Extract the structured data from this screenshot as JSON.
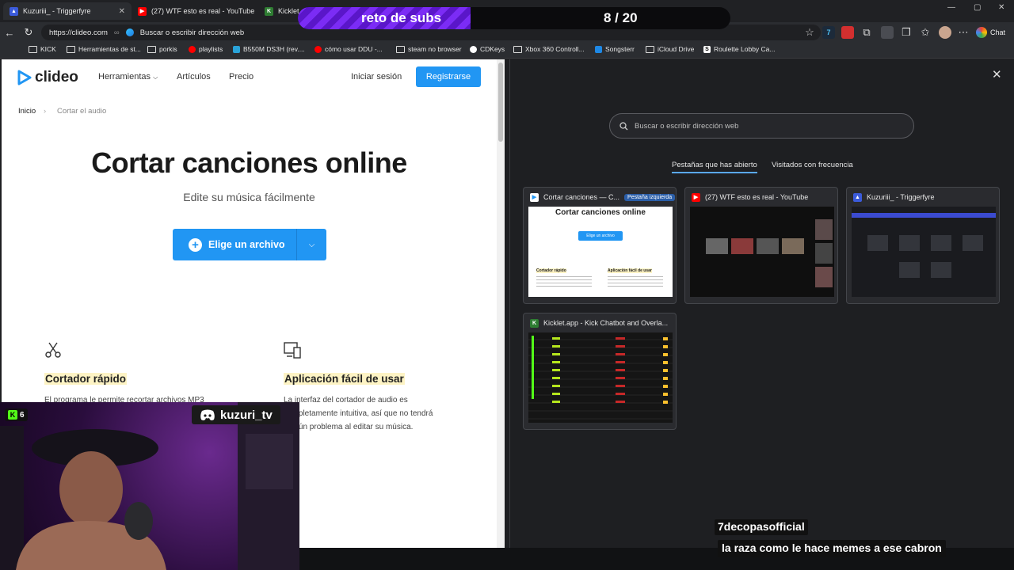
{
  "tabs": [
    {
      "title": "Kuzuriii_ - Triggerfyre",
      "favicon": "triggerfyre-icon",
      "color": "#3b5bdb"
    },
    {
      "title": "(27) WTF esto es real - YouTube",
      "favicon": "youtube-icon",
      "color": "#ff0000"
    },
    {
      "title": "Kicklet.ap",
      "favicon": "kicklet-icon",
      "color": "#2e7d32"
    }
  ],
  "address": {
    "url": "https://clideo.com",
    "placeholder": "Buscar o escribir dirección web"
  },
  "toolbar": {
    "chat_label": "Chat"
  },
  "bookmarks": [
    {
      "label": "KICK",
      "icon": "folder-icon"
    },
    {
      "label": "Herramientas de st...",
      "icon": "folder-icon"
    },
    {
      "label": "porkis",
      "icon": "folder-icon"
    },
    {
      "label": "playlists",
      "icon": "youtube-icon"
    },
    {
      "label": "B550M DS3H (rev....",
      "icon": "gigabyte-icon"
    },
    {
      "label": "cómo usar DDU -...",
      "icon": "youtube-icon"
    },
    {
      "label": "steam no browser",
      "icon": "folder-icon"
    },
    {
      "label": "CDKeys",
      "icon": "cdkeys-icon"
    },
    {
      "label": "Xbox 360 Controll...",
      "icon": "folder-icon"
    },
    {
      "label": "Songsterr",
      "icon": "songsterr-icon"
    },
    {
      "label": "iCloud Drive",
      "icon": "folder-icon"
    },
    {
      "label": "Roulette Lobby Ca...",
      "icon": "stake-icon"
    }
  ],
  "subs_goal": {
    "label": "reto de subs",
    "count": "8 / 20",
    "progress": 0.4
  },
  "clideo": {
    "logo": "clideo",
    "nav": {
      "tools": "Herramientas",
      "articles": "Artículos",
      "price": "Precio",
      "login": "Iniciar sesión",
      "register": "Registrarse"
    },
    "breadcrumb": {
      "home": "Inicio",
      "current": "Cortar el audio"
    },
    "title": "Cortar canciones online",
    "subtitle": "Edite su música fácilmente",
    "choose_button": "Elige un archivo",
    "features": [
      {
        "title": "Cortador rápido",
        "text": "El programa le permite recortar archivos MP3",
        "icon": "scissors-icon"
      },
      {
        "title": "Aplicación fácil de usar",
        "text": "La interfaz del cortador de audio es completamente intuitiva, así que no tendrá ningún problema al editar su música.",
        "icon": "devices-icon"
      }
    ]
  },
  "stream": {
    "kick_count": "6",
    "discord_name": "kuzuri_tv"
  },
  "newtab": {
    "search_placeholder": "Buscar o escribir dirección web",
    "tab_open": "Pestañas que has abierto",
    "tab_frequent": "Visitados con frecuencia",
    "cards": [
      {
        "title": "Cortar canciones — C...",
        "badge": "Pestaña izquierda",
        "preview_title": "Cortar canciones online",
        "preview_button": "Elige un archivo",
        "preview_f1": "Cortador rápido",
        "preview_f2": "Aplicación fácil de usar",
        "icon": "clideo-icon"
      },
      {
        "title": "(27) WTF esto es real - YouTube",
        "icon": "youtube-icon"
      },
      {
        "title": "Kuzuriii_ - Triggerfyre",
        "icon": "triggerfyre-icon"
      },
      {
        "title": "Kicklet.app - Kick Chatbot and Overla...",
        "icon": "kicklet-icon"
      }
    ]
  },
  "chat": {
    "user": "7decopasofficial",
    "message": "la raza como le hace memes a ese cabron"
  },
  "colors": {
    "accent": "#2196f3",
    "kick_green": "#53fc18",
    "subs_purple": "#7b2cf5",
    "highlight": "#fdf3c4"
  }
}
